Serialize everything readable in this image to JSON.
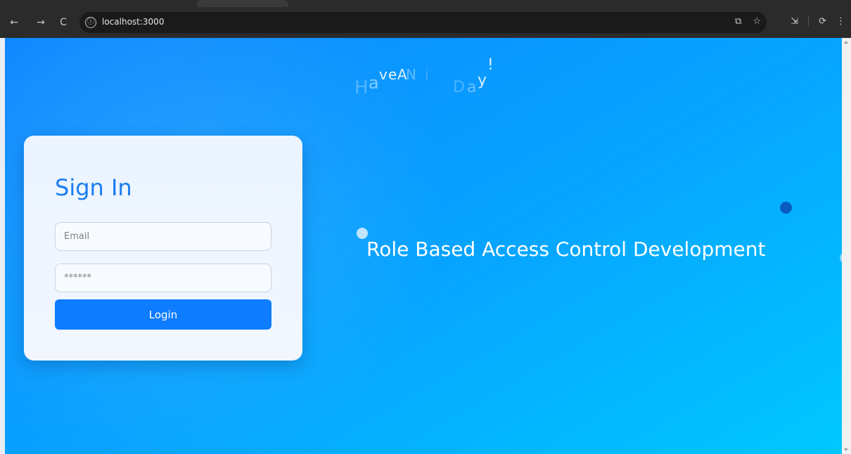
{
  "browser": {
    "url": "localhost:3000",
    "nav_back": "←",
    "nav_forward": "→",
    "reload": "C",
    "info_icon": "ⓘ",
    "actions": [
      "⧉",
      "☆"
    ],
    "tools": [
      "⇲",
      "⟳",
      "⋮"
    ]
  },
  "hero": {
    "animated_letters": [
      "H",
      "a",
      "v",
      "e",
      "A",
      "N",
      "i",
      "D",
      "a",
      "y",
      "!"
    ],
    "headline": "Role Based Access Control Development"
  },
  "signin": {
    "title": "Sign In",
    "email_placeholder": "Email",
    "password_placeholder": "******",
    "login_label": "Login"
  },
  "colors": {
    "accent": "#0d7cff",
    "title_blue": "#1c7cf0",
    "bg_start": "#0d86ff",
    "bg_end": "#00c8ff"
  }
}
